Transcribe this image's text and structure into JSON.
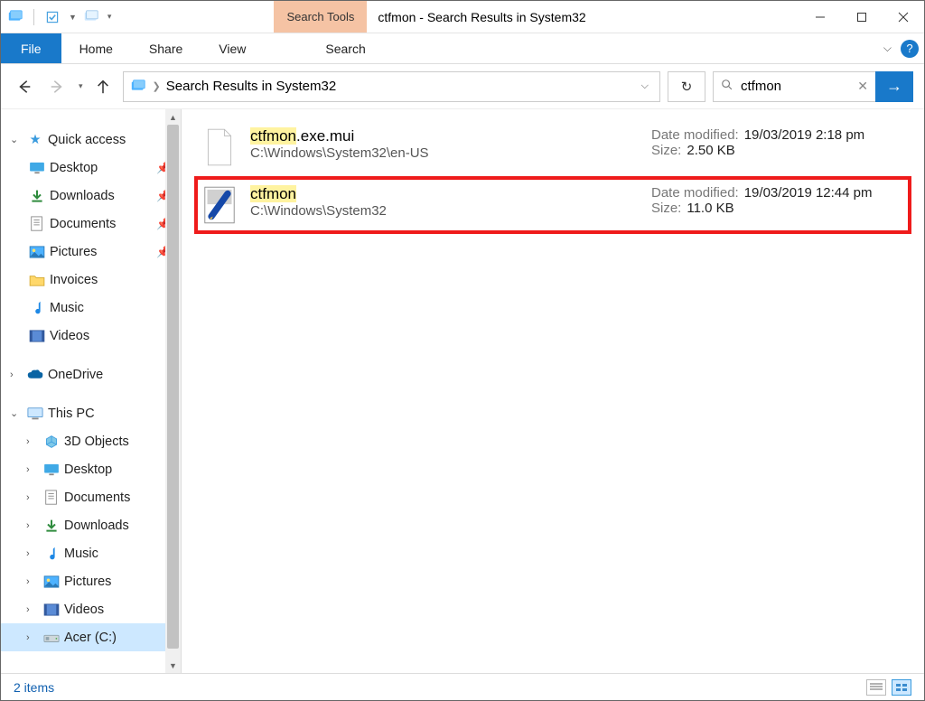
{
  "titlebar": {
    "context_tab": "Search Tools",
    "title": "ctfmon - Search Results in System32"
  },
  "ribbon": {
    "file": "File",
    "tabs": [
      "Home",
      "Share",
      "View",
      "Search"
    ]
  },
  "addressbar": {
    "location": "Search Results in System32"
  },
  "search": {
    "query": "ctfmon"
  },
  "sidebar": {
    "quick_access": "Quick access",
    "qa_items": [
      {
        "label": "Desktop",
        "pinned": true,
        "icon": "desktop"
      },
      {
        "label": "Downloads",
        "pinned": true,
        "icon": "downloads"
      },
      {
        "label": "Documents",
        "pinned": true,
        "icon": "documents"
      },
      {
        "label": "Pictures",
        "pinned": true,
        "icon": "pictures"
      },
      {
        "label": "Invoices",
        "pinned": false,
        "icon": "folder"
      },
      {
        "label": "Music",
        "pinned": false,
        "icon": "music"
      },
      {
        "label": "Videos",
        "pinned": false,
        "icon": "videos"
      }
    ],
    "onedrive": "OneDrive",
    "thispc": "This PC",
    "pc_items": [
      {
        "label": "3D Objects",
        "icon": "3d"
      },
      {
        "label": "Desktop",
        "icon": "desktop"
      },
      {
        "label": "Documents",
        "icon": "documents"
      },
      {
        "label": "Downloads",
        "icon": "downloads"
      },
      {
        "label": "Music",
        "icon": "music"
      },
      {
        "label": "Pictures",
        "icon": "pictures"
      },
      {
        "label": "Videos",
        "icon": "videos"
      },
      {
        "label": "Acer (C:)",
        "icon": "drive",
        "selected": true
      }
    ]
  },
  "results": [
    {
      "name_hl": "ctfmon",
      "name_rest": ".exe.mui",
      "path": "C:\\Windows\\System32\\en-US",
      "date_label": "Date modified:",
      "date": "19/03/2019 2:18 pm",
      "size_label": "Size:",
      "size": "2.50 KB",
      "highlighted": false,
      "icon": "file"
    },
    {
      "name_hl": "ctfmon",
      "name_rest": "",
      "path": "C:\\Windows\\System32",
      "date_label": "Date modified:",
      "date": "19/03/2019 12:44 pm",
      "size_label": "Size:",
      "size": "11.0 KB",
      "highlighted": true,
      "icon": "exe"
    }
  ],
  "statusbar": {
    "count": "2 items"
  }
}
